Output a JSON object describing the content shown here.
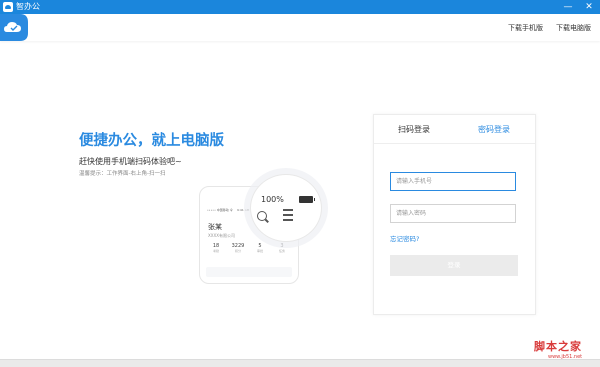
{
  "window": {
    "title": "智办公",
    "minimize_label": "—",
    "close_label": "✕"
  },
  "header": {
    "links": [
      {
        "label": "下载手机版"
      },
      {
        "label": "下载电脑版"
      }
    ]
  },
  "hero": {
    "title": "便捷办公，就上电脑版",
    "subtitle": "赶快使用手机端扫码体验吧~",
    "tip": "温馨提示：工作界面-右上角-扫一扫"
  },
  "phone_mock": {
    "status_carrier": "••••• 中国移动 令",
    "status_time": "9:41 AM",
    "name": "张某",
    "company": "XXXX有限公司",
    "stats": [
      {
        "value": "18",
        "label": "考勤"
      },
      {
        "value": "3229",
        "label": "积分"
      },
      {
        "value": "5",
        "label": "审批"
      },
      {
        "value": "3",
        "label": "任务"
      }
    ],
    "magnifier_battery": "100%"
  },
  "login": {
    "tabs": [
      {
        "label": "扫码登录",
        "active": false
      },
      {
        "label": "密码登录",
        "active": true
      }
    ],
    "phone_placeholder": "请输入手机号",
    "password_placeholder": "请输入密码",
    "forgot_label": "忘记密码?",
    "submit_label": "登录"
  },
  "watermark": {
    "text": "脚本之家",
    "url": "www.jb51.net"
  },
  "colors": {
    "accent": "#2a8ae0",
    "titlebar": "#1b86dc",
    "button_disabled": "#ebebeb"
  },
  "icons": [
    "app-icon",
    "cloud-logo-icon",
    "battery-icon",
    "search-icon",
    "menu-icon",
    "minimize-icon",
    "close-icon"
  ]
}
